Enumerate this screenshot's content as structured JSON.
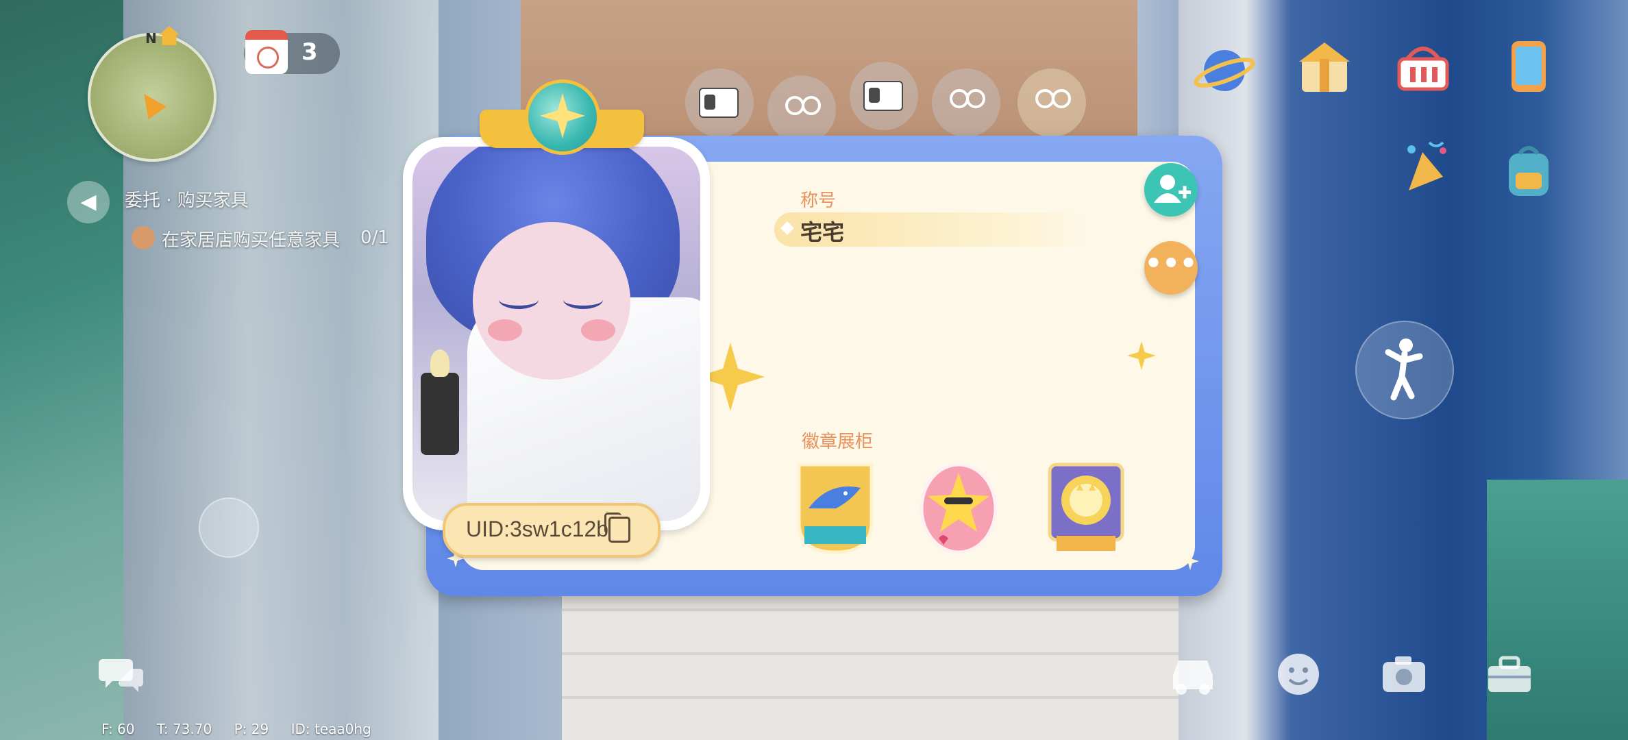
{
  "hud": {
    "minimap_north": "N",
    "calendar_count": "3",
    "stats": {
      "fps": "F: 60",
      "time": "T: 73.70",
      "ping": "P: 29",
      "id": "ID: teaa0hg"
    }
  },
  "quest": {
    "title": "委托 · 购买家具",
    "task": "在家居店购买任意家具",
    "progress": "0/1"
  },
  "profile": {
    "uid": "UID:3sw1c12b",
    "title_label": "称号",
    "title_value": "宅宅",
    "badges_label": "徽章展柜",
    "badges": [
      "shark-badge",
      "star-emoji-badge",
      "cat-ribbon-badge"
    ]
  },
  "icons": {
    "top_right": [
      "planet-icon",
      "gift-house-icon",
      "basket-icon",
      "tablet-icon",
      "party-popper-icon",
      "backpack-icon"
    ],
    "bottom_right": [
      "car-icon",
      "smile-icon",
      "camera-icon",
      "toolbox-icon"
    ]
  },
  "colors": {
    "card_blue": "#6a90ea",
    "card_cream": "#fdf8e8",
    "label_orange": "#e8915a",
    "friend_teal": "#3cc4b4",
    "more_orange": "#f2b25c"
  }
}
